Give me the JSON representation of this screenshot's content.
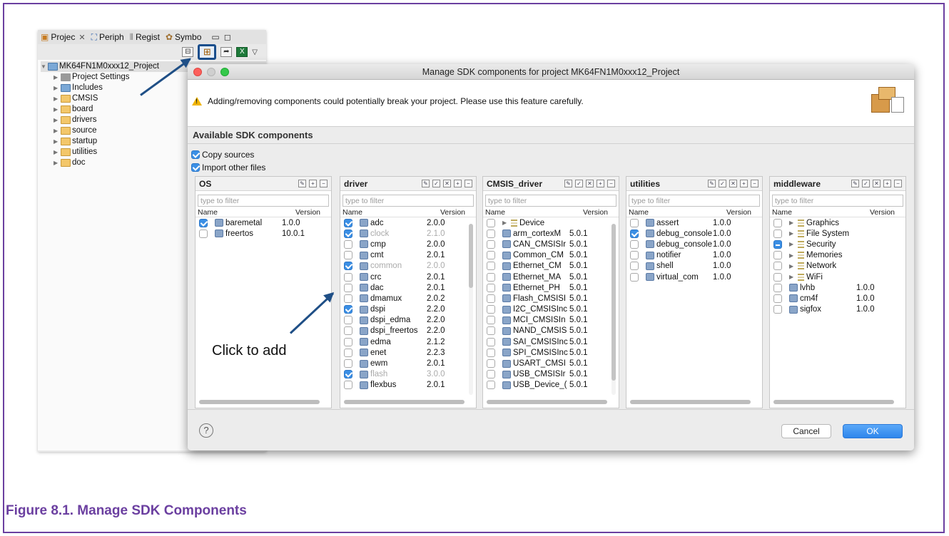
{
  "explorer": {
    "tabs": [
      {
        "label": "Projec",
        "icon": "project-explorer-icon",
        "closable": true
      },
      {
        "label": "Periph",
        "icon": "peripherals-icon"
      },
      {
        "label": "Regist",
        "icon": "registers-icon"
      },
      {
        "label": "Symbo",
        "icon": "symbols-icon"
      }
    ],
    "project": "MK64FN1M0xxx12_Project",
    "items": [
      "Project Settings",
      "Includes",
      "CMSIS",
      "board",
      "drivers",
      "source",
      "startup",
      "utilities",
      "doc"
    ]
  },
  "dialog": {
    "title": "Manage SDK components for project MK64FN1M0xxx12_Project",
    "warning": "Adding/removing components could potentially break your project. Please use this feature carefully.",
    "section_title": "Available SDK components",
    "copy_sources": "Copy sources",
    "import_other": "Import other files",
    "filter_placeholder": "type to filter",
    "col_name": "Name",
    "col_version": "Version",
    "cancel": "Cancel",
    "ok": "OK",
    "help": "?"
  },
  "panels": {
    "os": {
      "title": "OS",
      "rows": [
        {
          "name": "baremetal",
          "version": "1.0.0",
          "checked": true
        },
        {
          "name": "freertos",
          "version": "10.0.1",
          "checked": false
        }
      ]
    },
    "driver": {
      "title": "driver",
      "rows": [
        {
          "name": "adc",
          "version": "2.0.0",
          "checked": true
        },
        {
          "name": "clock",
          "version": "2.1.0",
          "checked": true,
          "gray": true
        },
        {
          "name": "cmp",
          "version": "2.0.0",
          "checked": false
        },
        {
          "name": "cmt",
          "version": "2.0.1",
          "checked": false
        },
        {
          "name": "common",
          "version": "2.0.0",
          "checked": true,
          "gray": true
        },
        {
          "name": "crc",
          "version": "2.0.1",
          "checked": false
        },
        {
          "name": "dac",
          "version": "2.0.1",
          "checked": false
        },
        {
          "name": "dmamux",
          "version": "2.0.2",
          "checked": false
        },
        {
          "name": "dspi",
          "version": "2.2.0",
          "checked": true
        },
        {
          "name": "dspi_edma",
          "version": "2.2.0",
          "checked": false
        },
        {
          "name": "dspi_freertos",
          "version": "2.2.0",
          "checked": false
        },
        {
          "name": "edma",
          "version": "2.1.2",
          "checked": false
        },
        {
          "name": "enet",
          "version": "2.2.3",
          "checked": false
        },
        {
          "name": "ewm",
          "version": "2.0.1",
          "checked": false
        },
        {
          "name": "flash",
          "version": "3.0.0",
          "checked": true,
          "gray": true
        },
        {
          "name": "flexbus",
          "version": "2.0.1",
          "checked": false
        }
      ]
    },
    "cmsis": {
      "title": "CMSIS_driver",
      "rows": [
        {
          "name": "Device",
          "version": "",
          "checked": false,
          "group": true
        },
        {
          "name": "arm_cortexM",
          "version": "5.0.1",
          "checked": false
        },
        {
          "name": "CAN_CMSISIr",
          "version": "5.0.1",
          "checked": false
        },
        {
          "name": "Common_CM",
          "version": "5.0.1",
          "checked": false
        },
        {
          "name": "Ethernet_CM",
          "version": "5.0.1",
          "checked": false
        },
        {
          "name": "Ethernet_MA",
          "version": "5.0.1",
          "checked": false
        },
        {
          "name": "Ethernet_PH",
          "version": "5.0.1",
          "checked": false
        },
        {
          "name": "Flash_CMSISI",
          "version": "5.0.1",
          "checked": false
        },
        {
          "name": "I2C_CMSISInc",
          "version": "5.0.1",
          "checked": false
        },
        {
          "name": "MCI_CMSISIn",
          "version": "5.0.1",
          "checked": false
        },
        {
          "name": "NAND_CMSIS",
          "version": "5.0.1",
          "checked": false
        },
        {
          "name": "SAI_CMSISInc",
          "version": "5.0.1",
          "checked": false
        },
        {
          "name": "SPI_CMSISInc",
          "version": "5.0.1",
          "checked": false
        },
        {
          "name": "USART_CMSI",
          "version": "5.0.1",
          "checked": false
        },
        {
          "name": "USB_CMSISIr",
          "version": "5.0.1",
          "checked": false
        },
        {
          "name": "USB_Device_(",
          "version": "5.0.1",
          "checked": false
        }
      ]
    },
    "utilities": {
      "title": "utilities",
      "rows": [
        {
          "name": "assert",
          "version": "1.0.0",
          "checked": false
        },
        {
          "name": "debug_console",
          "version": "1.0.0",
          "checked": true
        },
        {
          "name": "debug_console",
          "version": "1.0.0",
          "checked": false
        },
        {
          "name": "notifier",
          "version": "1.0.0",
          "checked": false
        },
        {
          "name": "shell",
          "version": "1.0.0",
          "checked": false
        },
        {
          "name": "virtual_com",
          "version": "1.0.0",
          "checked": false
        }
      ]
    },
    "middleware": {
      "title": "middleware",
      "rows": [
        {
          "name": "Graphics",
          "version": "",
          "checked": false,
          "group": true
        },
        {
          "name": "File System",
          "version": "",
          "checked": false,
          "group": true
        },
        {
          "name": "Security",
          "version": "",
          "checked": false,
          "group": true,
          "mixed": true
        },
        {
          "name": "Memories",
          "version": "",
          "checked": false,
          "group": true
        },
        {
          "name": "Network",
          "version": "",
          "checked": false,
          "group": true
        },
        {
          "name": "WiFi",
          "version": "",
          "checked": false,
          "group": true
        },
        {
          "name": "lvhb",
          "version": "1.0.0",
          "checked": false
        },
        {
          "name": "cm4f",
          "version": "1.0.0",
          "checked": false
        },
        {
          "name": "sigfox",
          "version": "1.0.0",
          "checked": false
        }
      ]
    }
  },
  "annotation": "Click to add",
  "caption": "Figure 8.1. Manage SDK Components",
  "colors": {
    "frame": "#6b3fa0",
    "arrow": "#1f4f86",
    "checkbox": "#3b8fe5",
    "ok_button": "#2e86ec"
  }
}
